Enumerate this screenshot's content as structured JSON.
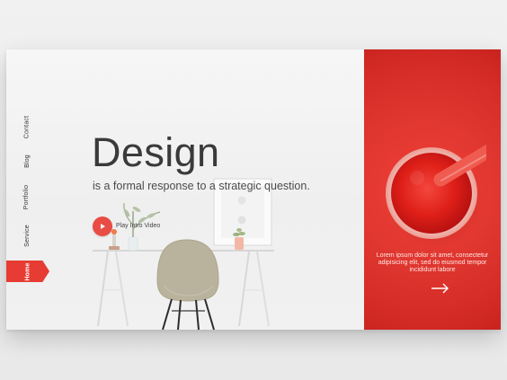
{
  "navigation": {
    "items": [
      {
        "label": "Contact"
      },
      {
        "label": "Blog"
      },
      {
        "label": "Portfolio"
      },
      {
        "label": "Service"
      },
      {
        "label": "Home",
        "active": true
      }
    ]
  },
  "hero": {
    "title": "Design",
    "subtitle": "is a formal response to a strategic question.",
    "video_label": "Play Intro Video"
  },
  "right_panel": {
    "text": "Lorem ipsum dolor sit amet, consectetur adipisicing elit, sed do eiusmod tempor incididunt labore"
  },
  "icons": {
    "play": "play-icon",
    "arrow": "arrow-right-icon"
  },
  "colors": {
    "accent": "#e63c34",
    "text_dark": "#3a3a3a",
    "panel_red": "#df342d",
    "page_bg": "#efefef"
  }
}
